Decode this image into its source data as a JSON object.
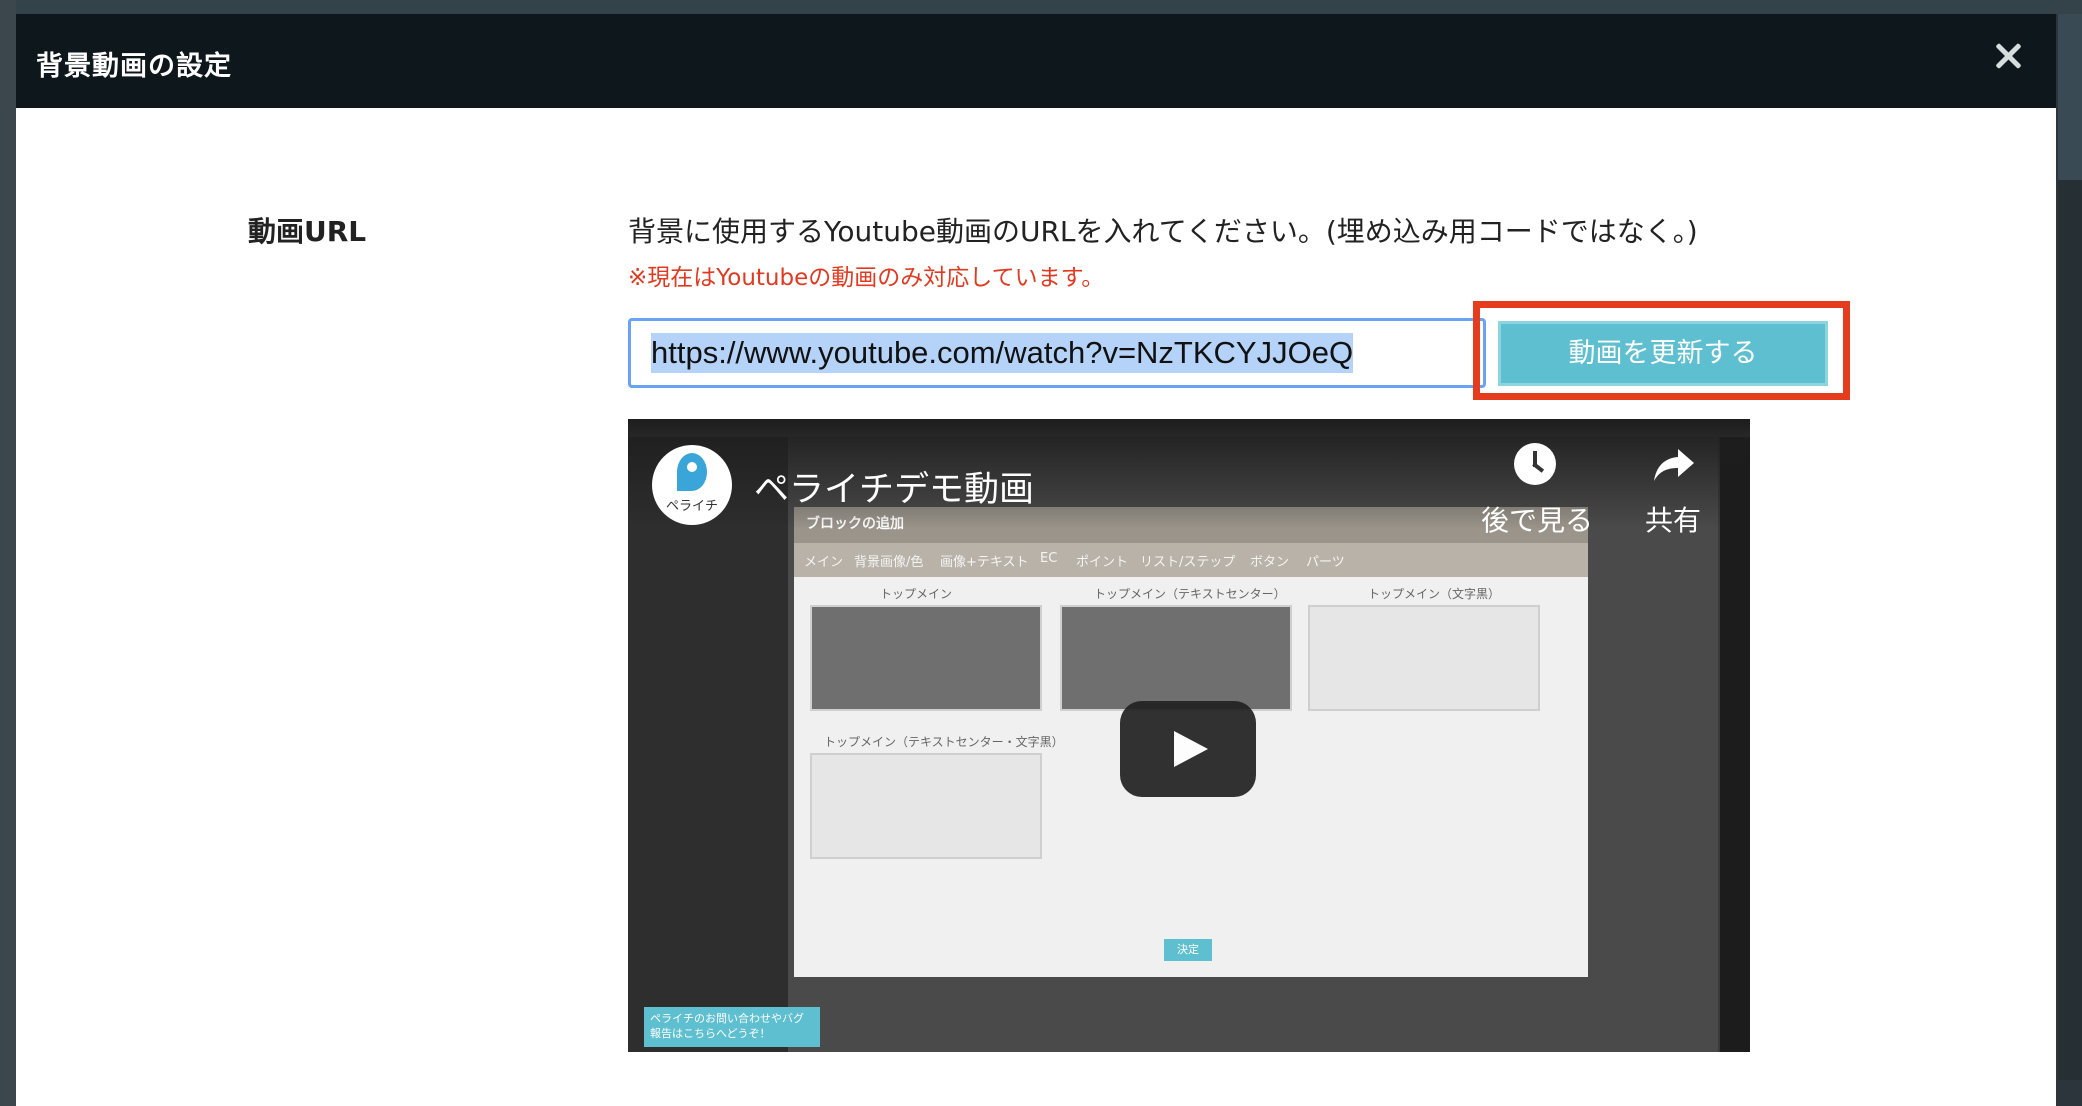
{
  "background": {
    "logo_text": "ペライチ"
  },
  "modal": {
    "title": "背景動画の設定",
    "field_label": "動画URL",
    "description": "背景に使用するYoutube動画のURLを入れてください。(埋め込み用コードではなく。)",
    "note": "※現在はYoutubeの動画のみ対応しています。",
    "url_value": "https://www.youtube.com/watch?v=NzTKCYJJOeQ",
    "update_button_label": "動画を更新する",
    "highlight_color": "#e63c1e",
    "accent_color": "#5dbfd0"
  },
  "video": {
    "channel_name": "ペライチ",
    "title": "ペライチデモ動画",
    "watch_later_label": "後で見る",
    "share_label": "共有",
    "inner": {
      "panel_title": "ブロックの追加",
      "tabs": [
        "メイン",
        "背景画像/色",
        "画像+テキスト",
        "EC",
        "ポイント",
        "リスト/ステップ",
        "ボタン",
        "パーツ"
      ],
      "thumb_labels": [
        "トップメイン",
        "トップメイン（テキストセンター）",
        "トップメイン（文字黒）",
        "トップメイン（テキストセンター・文字黒）"
      ],
      "decide_label": "決定",
      "help_text": "ペライチのお問い合わせやバグ報告はこちらへどうぞ！"
    }
  }
}
